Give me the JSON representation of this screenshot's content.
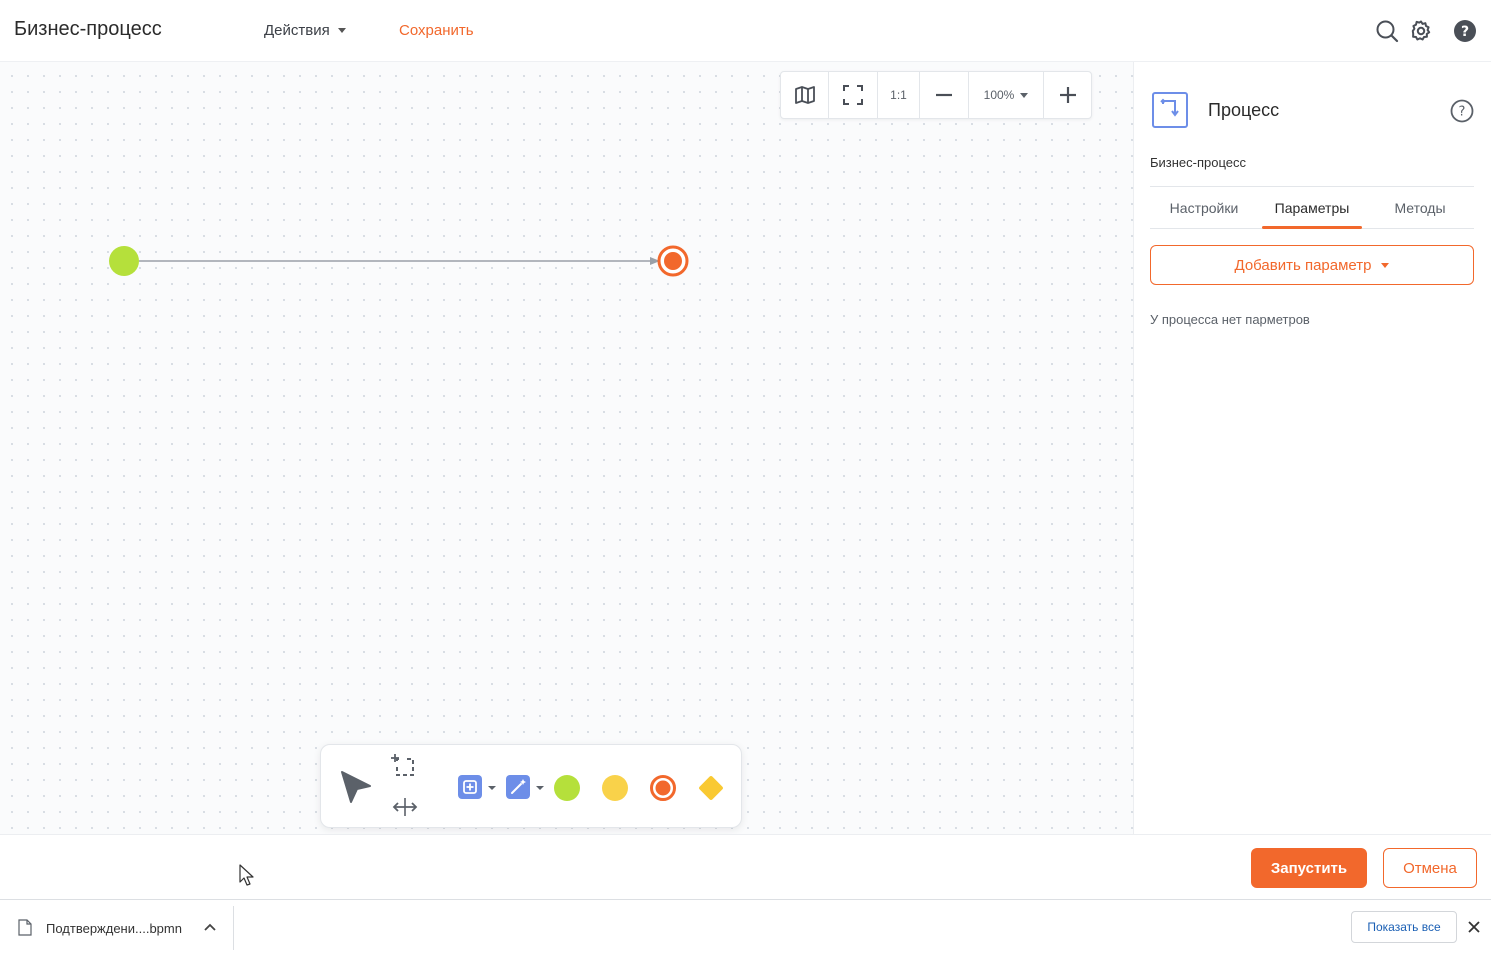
{
  "header": {
    "title": "Бизнес-процесс",
    "actions_label": "Действия",
    "save_label": "Сохранить",
    "icons": [
      "search-icon",
      "gear-icon",
      "help-icon"
    ]
  },
  "canvas": {
    "zoom_toolbar": {
      "minimap_icon": "map-icon",
      "fit_icon": "fullscreen-icon",
      "actual_size_label": "1:1",
      "zoom_out_icon": "minus-icon",
      "zoom_value": "100%",
      "zoom_in_icon": "plus-icon"
    },
    "start_event_color": "#b5e03b",
    "end_event_color": "#f2682c",
    "shape_toolbar": {
      "items": [
        "pointer-tool",
        "lasso-tool",
        "space-tool",
        "task-tool",
        "magic-tool",
        "start-event-tool",
        "intermediate-event-tool",
        "end-event-tool",
        "gateway-tool"
      ],
      "colors": {
        "task": "#6d8ee8",
        "start": "#b5e03b",
        "intermediate": "#f9d24a",
        "end": "#f2682c",
        "gateway": "#f9c932"
      }
    }
  },
  "panel": {
    "title": "Процесс",
    "subtitle": "Бизнес-процесс",
    "tabs": [
      {
        "label": "Настройки",
        "active": false
      },
      {
        "label": "Параметры",
        "active": true
      },
      {
        "label": "Методы",
        "active": false
      }
    ],
    "add_param_label": "Добавить параметр",
    "empty_text": "У процесса нет парметров"
  },
  "footer": {
    "run_label": "Запустить",
    "cancel_label": "Отмена"
  },
  "download_bar": {
    "file_name": "Подтверждени....bpmn",
    "show_all_label": "Показать все"
  },
  "accent_color": "#f2682c"
}
